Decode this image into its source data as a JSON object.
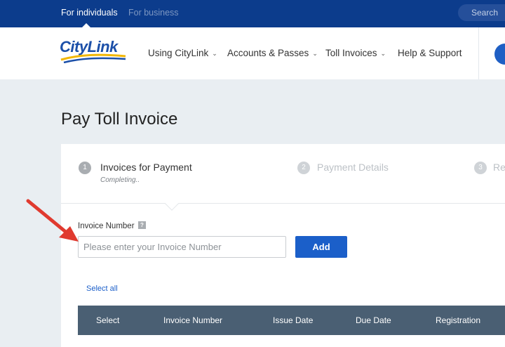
{
  "topbar": {
    "audience_individuals": "For individuals",
    "audience_business": "For business",
    "search_label": "Search"
  },
  "brand": {
    "logo_text": "CityLink"
  },
  "nav": {
    "items": [
      {
        "label": "Using CityLink",
        "has_dropdown": true
      },
      {
        "label": "Accounts & Passes",
        "has_dropdown": true
      },
      {
        "label": "Toll Invoices",
        "has_dropdown": true
      },
      {
        "label": "Help & Support",
        "has_dropdown": false
      }
    ]
  },
  "page": {
    "title": "Pay Toll Invoice"
  },
  "steps": [
    {
      "number": "1",
      "label": "Invoices for Payment",
      "status": "Completing.."
    },
    {
      "number": "2",
      "label": "Payment Details"
    },
    {
      "number": "3",
      "label": "Re"
    }
  ],
  "invoice_form": {
    "label": "Invoice Number",
    "help_icon": "?",
    "placeholder": "Please enter your Invoice Number",
    "value": "",
    "add_label": "Add"
  },
  "table": {
    "select_all": "Select all",
    "columns": [
      "Select",
      "Invoice Number",
      "Issue Date",
      "Due Date",
      "Registration"
    ]
  },
  "colors": {
    "topbar": "#0c3c8c",
    "primary_button": "#1b5fc9",
    "table_header": "#4a5f73",
    "annotation_arrow": "#e03a2f"
  }
}
